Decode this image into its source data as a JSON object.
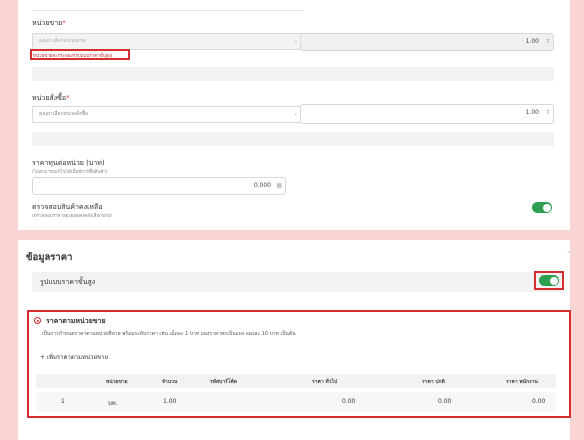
{
  "sale_unit": {
    "label": "หน่วยขาย",
    "required_mark": "*",
    "placeholder": "คุณยาเลือกหน่วยขาย",
    "error": "หน่วยขายจะกระจองกรุปแบบราคาขั้นสูง)",
    "factor_value": "1.00"
  },
  "order_unit": {
    "label": "หน่วยสั่งซื้อ",
    "required_mark": "*",
    "placeholder": "คุณยาเลือกหน่วยสั่งซื้อ",
    "factor_value": "1.00"
  },
  "cost": {
    "label": "ราคาทุนต่อหน่วย (บาท)",
    "hint": "(ไม่สามารถแก้ไขได้เมื่อมีการซื้อสินค้า)",
    "value": "0.000"
  },
  "stock_check": {
    "label": "ตรวจสอบสินค้าคงเหลือ",
    "hint": "(ตรวจสอบราคาสองยอดคงคลังเลือกขาย)",
    "enabled": true
  },
  "price_section": {
    "title": "ข้อมูลราคา",
    "advanced_label": "รูปแบบราคาขั้นสูง",
    "advanced_enabled": true
  },
  "unit_price": {
    "radio_label": "ราคาตามหน่วยขาย",
    "description": "เป็นการกำหนดราคาตามหน่วยที่ขาย พร้อมระดับราคา เช่น เม็ดละ 1 บาท แผงราคาหกเป็นแผง แผงละ 10 บาท เป็นต้น",
    "add_label": "+ เพิ่มราคาตามหน่วยขาย",
    "columns": [
      "หน่วยขาย",
      "จำนวน",
      "รหัสบาร์โค้ด",
      "ราคา ทั่วไป",
      "ราคา ปกติ",
      "ราคา พนักงาน"
    ],
    "rows": [
      {
        "index": "1",
        "unit": "บท.",
        "qty": "1.00",
        "barcode": "",
        "general": "0.00",
        "normal": "0.00",
        "staff": "0.00"
      }
    ]
  },
  "colors": {
    "accent_red": "#d32f2f",
    "toggle_green": "#2e9e4f",
    "background": "#f8d4d4"
  }
}
